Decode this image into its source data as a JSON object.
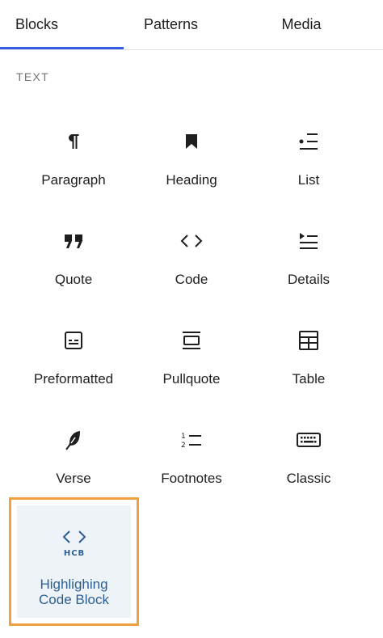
{
  "tabs": [
    {
      "label": "Blocks",
      "active": true
    },
    {
      "label": "Patterns",
      "active": false
    },
    {
      "label": "Media",
      "active": false
    }
  ],
  "section": {
    "title": "TEXT"
  },
  "blocks": [
    {
      "label": "Paragraph",
      "icon": "paragraph-icon"
    },
    {
      "label": "Heading",
      "icon": "bookmark-icon"
    },
    {
      "label": "List",
      "icon": "list-icon"
    },
    {
      "label": "Quote",
      "icon": "quote-icon"
    },
    {
      "label": "Code",
      "icon": "code-icon"
    },
    {
      "label": "Details",
      "icon": "details-icon"
    },
    {
      "label": "Preformatted",
      "icon": "preformatted-icon"
    },
    {
      "label": "Pullquote",
      "icon": "pullquote-icon"
    },
    {
      "label": "Table",
      "icon": "table-icon"
    },
    {
      "label": "Verse",
      "icon": "feather-icon"
    },
    {
      "label": "Footnotes",
      "icon": "footnotes-icon"
    },
    {
      "label": "Classic",
      "icon": "keyboard-icon"
    }
  ],
  "custom_block": {
    "label_line1": "Highlighing",
    "label_line2": "Code Block",
    "icon_text": "HCB",
    "highlight_color": "#f0a040",
    "accent_color": "#2b5e93"
  },
  "colors": {
    "tab_underline": "#3858e9"
  }
}
